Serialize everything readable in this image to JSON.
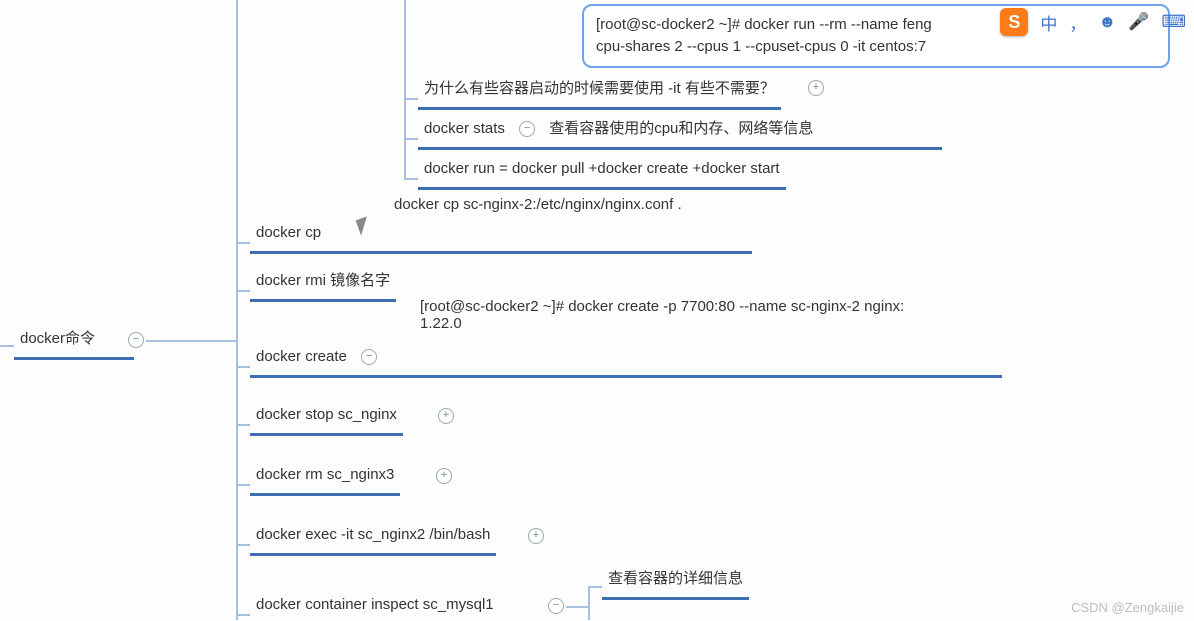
{
  "root": {
    "label": "docker命令"
  },
  "codebox": {
    "line1": "[root@sc-docker2 ~]# docker run --rm --name feng",
    "line2": "cpu-shares 2 --cpus 1 --cpuset-cpus 0   -it centos:7"
  },
  "ime": {
    "logo": "S",
    "lang": "中",
    "punct": "，",
    "face": "☻",
    "mic": "🎤",
    "kbd": "⌨"
  },
  "nodes": {
    "n1": "为什么有些容器启动的时候需要使用 -it 有些不需要？",
    "n2a": "docker  stats",
    "n2b": "查看容器使用的cpu和内存、网络等信息",
    "n3": "docker run = docker pull  +docker  create +docker start",
    "n4p": "docker cp sc-nginx-2:/etc/nginx/nginx.conf .",
    "n4": "docker cp",
    "n5": "docker rmi  镜像名字",
    "n6p1": "[root@sc-docker2 ~]# docker create  -p 7700:80  --name  sc-nginx-2  nginx:",
    "n6p2": "1.22.0",
    "n6": "docker create",
    "n7": "docker stop sc_nginx",
    "n8": "docker rm sc_nginx3",
    "n9": "docker exec -it sc_nginx2 /bin/bash",
    "n10": "docker container inspect sc_mysql1",
    "n10c": "查看容器的详细信息"
  },
  "watermark": "CSDN @Zengkaijie"
}
